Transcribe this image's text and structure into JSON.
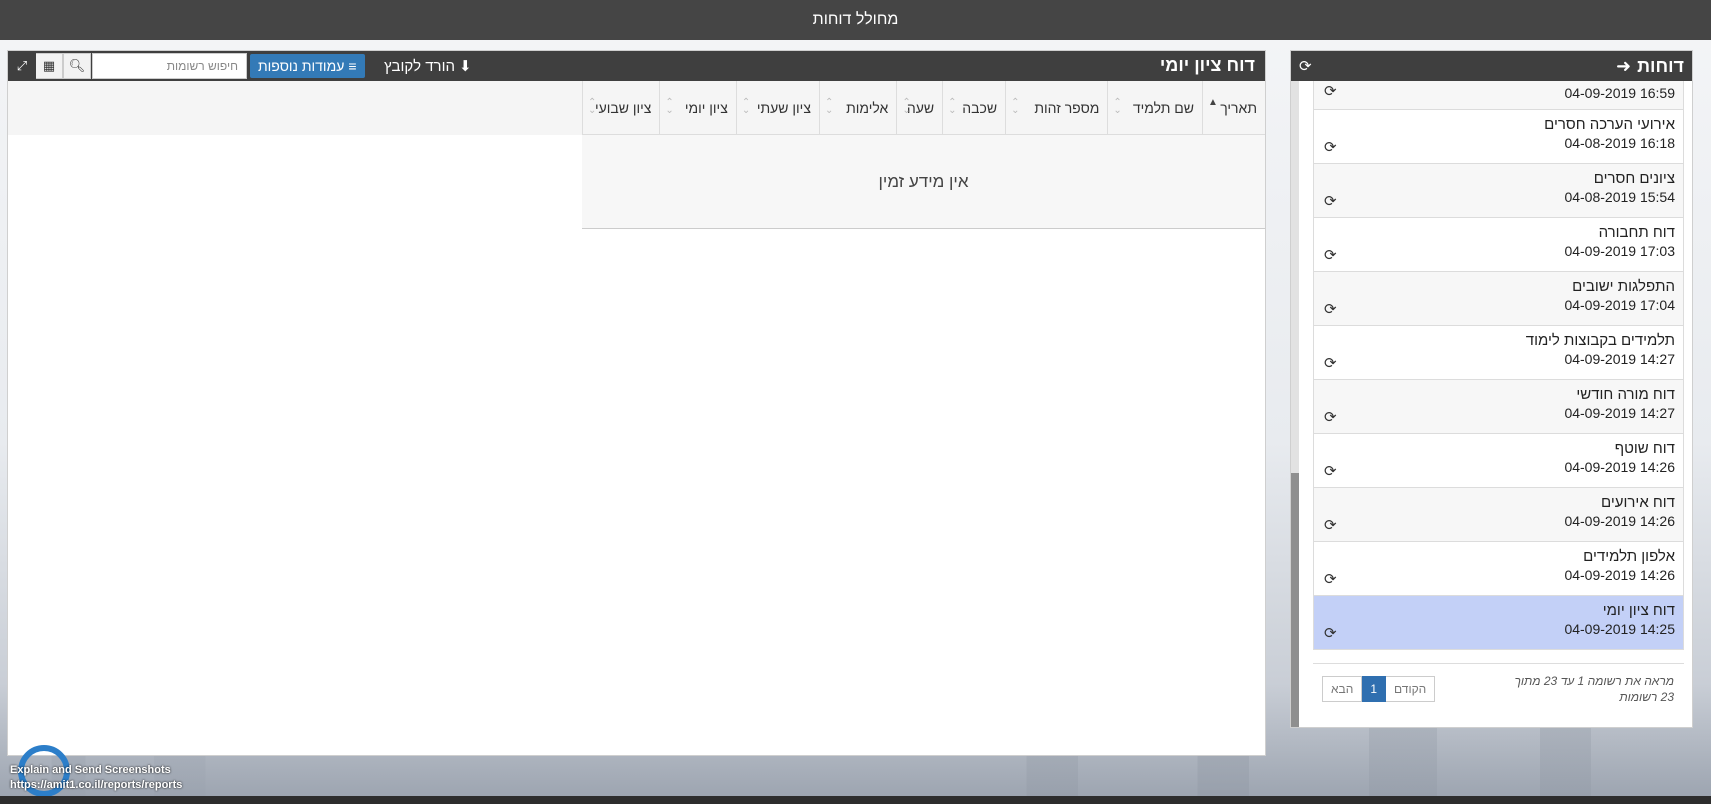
{
  "app": {
    "title": "מחולל דוחות"
  },
  "reports_panel": {
    "title": "דוחות",
    "icons": {
      "back": "arrow-right-icon",
      "refresh": "refresh-icon"
    },
    "items": [
      {
        "name": "",
        "date": "16:59 04-09-2019"
      },
      {
        "name": "אירועי הערכה חסרים",
        "date": "16:18 04-08-2019"
      },
      {
        "name": "ציונים חסרים",
        "date": "15:54 04-08-2019"
      },
      {
        "name": "דוח תחבורה",
        "date": "17:03 04-09-2019"
      },
      {
        "name": "התפלגות ישובים",
        "date": "17:04 04-09-2019"
      },
      {
        "name": "תלמידים בקבוצות לימוד",
        "date": "14:27 04-09-2019"
      },
      {
        "name": "דוח מורה חודשי",
        "date": "14:27 04-09-2019"
      },
      {
        "name": "דוח שוטף",
        "date": "14:26 04-09-2019"
      },
      {
        "name": "דוח אירועים",
        "date": "14:26 04-09-2019"
      },
      {
        "name": "אלפון תלמידים",
        "date": "14:26 04-09-2019"
      },
      {
        "name": "דוח ציון יומי",
        "date": "14:25 04-09-2019"
      }
    ],
    "active_index": 10,
    "paging_info": "מראה את רשומה 1 עד 23 מתוך 23 רשומות",
    "pager": {
      "prev": "הקודם",
      "current": "1",
      "next": "הבא"
    }
  },
  "main_panel": {
    "title": "דוח ציון יומי",
    "download_label": "הורד לקובץ",
    "columns_label": "עמודות נוספות",
    "search_placeholder": "חיפוש רשומות",
    "table": {
      "columns": [
        "תאריך",
        "שם תלמיד",
        "מספר זהות",
        "שכבה",
        "שעה",
        "אלימות",
        "ציון שעתי",
        "ציון יומי",
        "ציון שבועי"
      ],
      "sorted_column": "תאריך",
      "empty_message": "אין מידע זמין"
    }
  },
  "capture_widget": {
    "line1": "Explain and Send Screenshots",
    "line2": "https://amit1.co.il/reports/reports"
  }
}
